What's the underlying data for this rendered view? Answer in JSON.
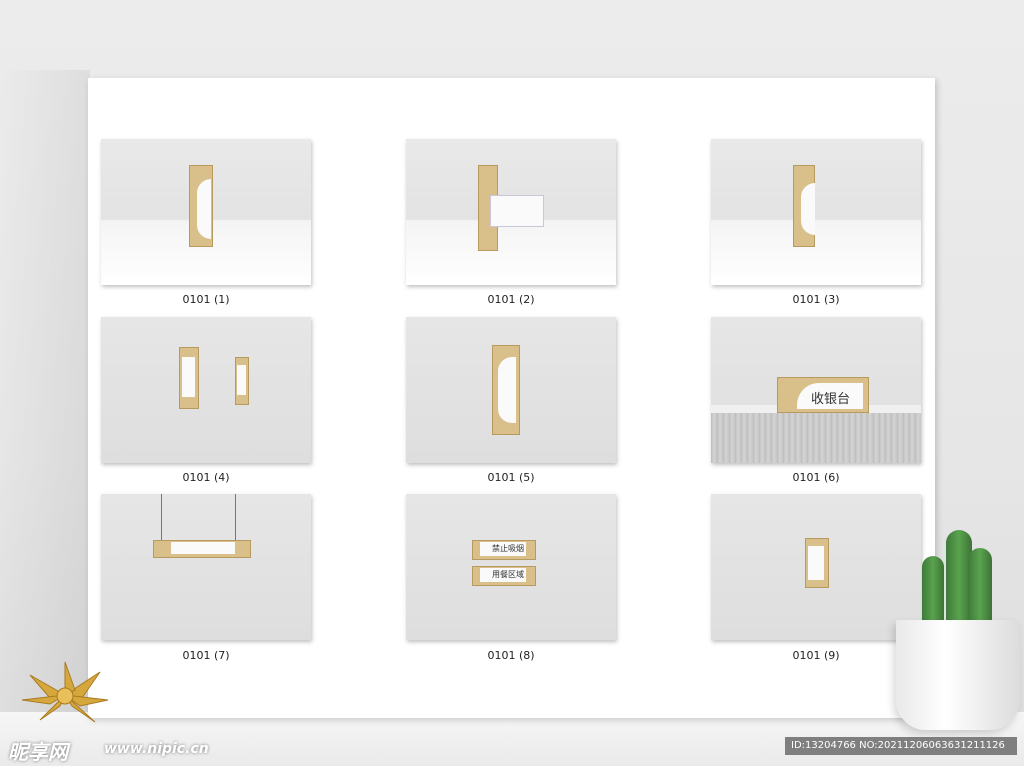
{
  "thumbnails": [
    {
      "caption": "0101 (1)"
    },
    {
      "caption": "0101 (2)"
    },
    {
      "caption": "0101 (3)"
    },
    {
      "caption": "0101 (4)"
    },
    {
      "caption": "0101 (5)"
    },
    {
      "caption": "0101 (6)"
    },
    {
      "caption": "0101 (7)"
    },
    {
      "caption": "0101 (8)"
    },
    {
      "caption": "0101 (9)"
    }
  ],
  "signs": {
    "thumb6_text": "收银台",
    "thumb8_top": "禁止吸烟",
    "thumb8_bottom": "用餐区域"
  },
  "watermark": {
    "logo": "昵享网",
    "url": "www.nipic.cn",
    "id_text": "ID:13204766 NO:20211206063631211126"
  }
}
